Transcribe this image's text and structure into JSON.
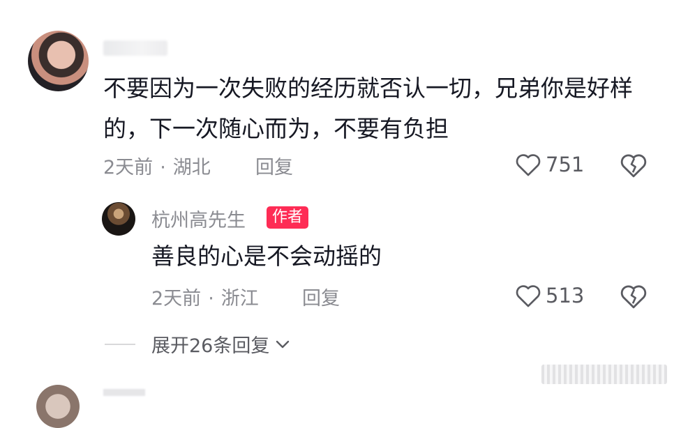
{
  "comment": {
    "text": "不要因为一次失败的经历就否认一切，兄弟你是好样的，下一次随心而为，不要有负担",
    "time": "2天前",
    "sep": "·",
    "location": "湖北",
    "reply_label": "回复",
    "likes": "751"
  },
  "reply": {
    "username": "杭州高先生",
    "badge": "作者",
    "text": "善良的心是不会动摇的",
    "time": "2天前",
    "sep": "·",
    "location": "浙江",
    "reply_label": "回复",
    "likes": "513"
  },
  "expand_label": "展开26条回复",
  "colors": {
    "badge": "#fe2c55",
    "meta": "#8a8b91",
    "text": "#161823"
  },
  "icons": {
    "like": "heart-outline-icon",
    "dislike": "broken-heart-icon",
    "expand": "chevron-down-icon"
  }
}
